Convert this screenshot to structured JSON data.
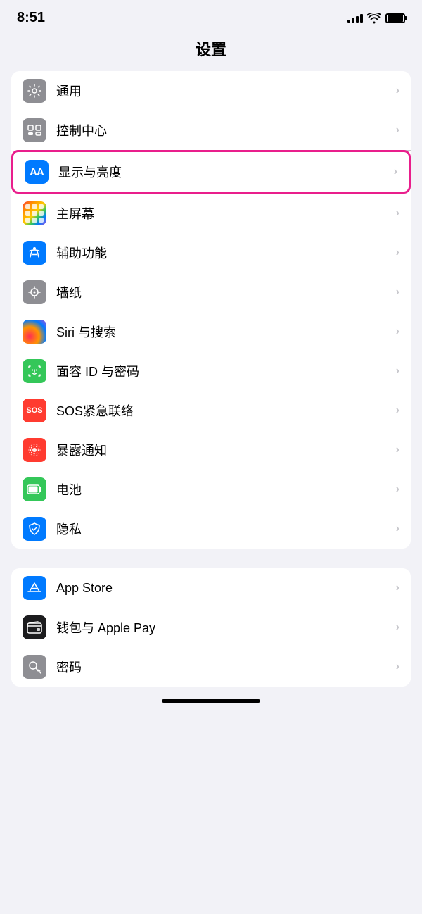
{
  "statusBar": {
    "time": "8:51",
    "signalBars": [
      3,
      5,
      7,
      9,
      11
    ],
    "wifi": "wifi",
    "battery": "battery"
  },
  "pageTitle": "设置",
  "groups": [
    {
      "id": "group1",
      "items": [
        {
          "id": "tongyong",
          "label": "通用",
          "iconBg": "icon-gray",
          "iconContent": "gear",
          "highlighted": false
        },
        {
          "id": "kongzhizhongxin",
          "label": "控制中心",
          "iconBg": "icon-gray2",
          "iconContent": "toggle",
          "highlighted": false
        },
        {
          "id": "xianshiyliangliang",
          "label": "显示与亮度",
          "iconBg": "icon-blue",
          "iconContent": "aa",
          "highlighted": true
        },
        {
          "id": "zhupingmu",
          "label": "主屏幕",
          "iconBg": "icon-colorful",
          "iconContent": "grid",
          "highlighted": false
        },
        {
          "id": "fuzhugneng",
          "label": "辅助功能",
          "iconBg": "icon-blue-accessibility",
          "iconContent": "accessibility",
          "highlighted": false
        },
        {
          "id": "qiangzhi",
          "label": "墙纸",
          "iconBg": "icon-gray-wallpaper",
          "iconContent": "flower",
          "highlighted": false
        },
        {
          "id": "siri",
          "label": "Siri 与搜索",
          "iconBg": "icon-siri",
          "iconContent": "siri",
          "highlighted": false
        },
        {
          "id": "faceid",
          "label": "面容 ID 与密码",
          "iconBg": "icon-green-faceid",
          "iconContent": "faceid",
          "highlighted": false
        },
        {
          "id": "sos",
          "label": "SOS紧急联络",
          "iconBg": "icon-red-sos",
          "iconContent": "sos",
          "highlighted": false
        },
        {
          "id": "baolu",
          "label": "暴露通知",
          "iconBg": "icon-pink-exposure",
          "iconContent": "exposure",
          "highlighted": false
        },
        {
          "id": "dianci",
          "label": "电池",
          "iconBg": "icon-green-battery",
          "iconContent": "battery",
          "highlighted": false
        },
        {
          "id": "yinsi",
          "label": "隐私",
          "iconBg": "icon-blue-privacy",
          "iconContent": "hand",
          "highlighted": false
        }
      ]
    },
    {
      "id": "group2",
      "items": [
        {
          "id": "appstore",
          "label": "App Store",
          "iconBg": "icon-blue-appstore",
          "iconContent": "appstore",
          "highlighted": false
        },
        {
          "id": "wallet",
          "label": "钱包与 Apple Pay",
          "iconBg": "icon-dark-wallet",
          "iconContent": "wallet",
          "highlighted": false
        },
        {
          "id": "passwords",
          "label": "密码",
          "iconBg": "icon-gray-passwords",
          "iconContent": "key",
          "highlighted": false
        }
      ]
    }
  ]
}
